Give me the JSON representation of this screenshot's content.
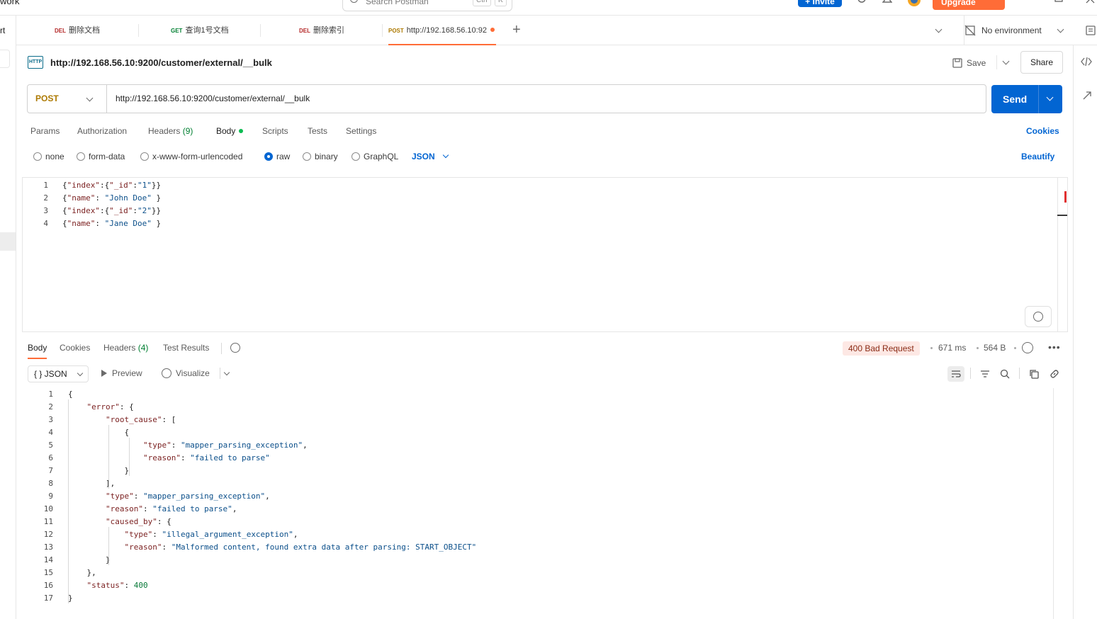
{
  "topbar": {
    "workspace": "work",
    "search_placeholder": "Search Postman",
    "search_kbd1": "Ctrl",
    "search_kbd2": "K",
    "invite_label": "+ Invite",
    "upgrade_label": "Upgrade"
  },
  "leftrail": {
    "label": "rt"
  },
  "tabs": [
    {
      "method": "DEL",
      "name": "删除文档"
    },
    {
      "method": "GET",
      "name": "查询1号文档"
    },
    {
      "method": "DEL",
      "name": "删除索引"
    },
    {
      "method": "POST",
      "name": "http://192.168.56.10:92"
    }
  ],
  "environment": {
    "label": "No environment"
  },
  "request": {
    "title": "http://192.168.56.10:9200/customer/external/__bulk",
    "save_label": "Save",
    "share_label": "Share",
    "method": "POST",
    "url": "http://192.168.56.10:9200/customer/external/__bulk",
    "send_label": "Send",
    "http_badge": "HTTP",
    "subtabs": {
      "params": "Params",
      "authorization": "Authorization",
      "headers": "Headers",
      "headers_count": "(9)",
      "body": "Body",
      "scripts": "Scripts",
      "tests": "Tests",
      "settings": "Settings"
    },
    "cookies_label": "Cookies",
    "body_types": {
      "none": "none",
      "form_data": "form-data",
      "urlencoded": "x-www-form-urlencoded",
      "raw": "raw",
      "binary": "binary",
      "graphql": "GraphQL"
    },
    "selected_body_type": "raw",
    "format": "JSON",
    "beautify_label": "Beautify",
    "body_lines": [
      {
        "n": "1",
        "t": "{\"index\":{\"_id\":\"1\"}}"
      },
      {
        "n": "2",
        "t": "{\"name\": \"John Doe\" }"
      },
      {
        "n": "3",
        "t": "{\"index\":{\"_id\":\"2\"}}"
      },
      {
        "n": "4",
        "t": "{\"name\": \"Jane Doe\" }"
      }
    ]
  },
  "response": {
    "tabs": {
      "body": "Body",
      "cookies": "Cookies",
      "headers": "Headers",
      "headers_count": "(4)",
      "test_results": "Test Results"
    },
    "status": "400 Bad Request",
    "time": "671 ms",
    "size": "564 B",
    "format_label": "{ } JSON",
    "preview_label": "Preview",
    "visualize_label": "Visualize",
    "lines": [
      {
        "n": "1",
        "t": "{"
      },
      {
        "n": "2",
        "t": "    \"error\": {"
      },
      {
        "n": "3",
        "t": "        \"root_cause\": ["
      },
      {
        "n": "4",
        "t": "            {"
      },
      {
        "n": "5",
        "t": "                \"type\": \"mapper_parsing_exception\","
      },
      {
        "n": "6",
        "t": "                \"reason\": \"failed to parse\""
      },
      {
        "n": "7",
        "t": "            }"
      },
      {
        "n": "8",
        "t": "        ],"
      },
      {
        "n": "9",
        "t": "        \"type\": \"mapper_parsing_exception\","
      },
      {
        "n": "10",
        "t": "        \"reason\": \"failed to parse\","
      },
      {
        "n": "11",
        "t": "        \"caused_by\": {"
      },
      {
        "n": "12",
        "t": "            \"type\": \"illegal_argument_exception\","
      },
      {
        "n": "13",
        "t": "            \"reason\": \"Malformed content, found extra data after parsing: START_OBJECT\""
      },
      {
        "n": "14",
        "t": "        }"
      },
      {
        "n": "15",
        "t": "    },"
      },
      {
        "n": "16",
        "t": "    \"status\": 400"
      },
      {
        "n": "17",
        "t": "}"
      }
    ]
  },
  "colors": {
    "accent": "#ff6c37",
    "send": "#0265d2",
    "post": "#ad7a03",
    "get": "#007f31",
    "del": "#b52a2a",
    "error_bg": "#fde8e4"
  },
  "icons": [
    "search-icon",
    "http-icon",
    "save-icon",
    "chevron-down-icon",
    "plus-icon",
    "no-environment-icon",
    "history-icon",
    "globe-icon",
    "more-icon",
    "wrap-icon",
    "filter-icon",
    "copy-icon",
    "link-icon",
    "code-icon",
    "ai-icon"
  ]
}
